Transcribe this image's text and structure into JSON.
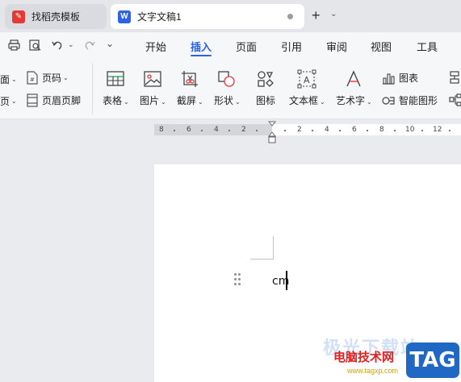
{
  "tabs": [
    {
      "title": "找稻壳模板",
      "icon": "docer-icon",
      "color": "#e53935"
    },
    {
      "title": "文字文稿1",
      "icon": "word-doc-icon",
      "color": "#2b62e8"
    }
  ],
  "new_tab": "+",
  "quick_access": [
    "print-icon",
    "print-preview-icon",
    "undo-icon",
    "redo-icon",
    "more-icon"
  ],
  "menu": [
    "开始",
    "插入",
    "页面",
    "引用",
    "审阅",
    "视图",
    "工具"
  ],
  "active_menu": "插入",
  "ribbon": {
    "small_left": [
      "面",
      "页"
    ],
    "small": [
      {
        "label": "页码",
        "icon": "page-number-icon"
      },
      {
        "label": "页眉页脚",
        "icon": "header-footer-icon"
      }
    ],
    "big": [
      {
        "label": "表格",
        "icon": "table-icon"
      },
      {
        "label": "图片",
        "icon": "picture-icon"
      },
      {
        "label": "截屏",
        "icon": "screenshot-icon"
      },
      {
        "label": "形状",
        "icon": "shape-icon"
      },
      {
        "label": "图标",
        "icon": "icon-library-icon"
      },
      {
        "label": "文本框",
        "icon": "textbox-icon"
      },
      {
        "label": "艺术字",
        "icon": "wordart-icon"
      }
    ],
    "right": [
      {
        "label": "图表",
        "icon": "chart-icon"
      },
      {
        "label": "智能图形",
        "icon": "smartart-icon"
      }
    ]
  },
  "ruler": {
    "left_ticks": [
      "8",
      "6",
      "4",
      "2"
    ],
    "right_ticks": [
      "2",
      "4",
      "6",
      "8",
      "10",
      "12"
    ]
  },
  "document": {
    "text": "cm"
  },
  "watermark": {
    "bg_text": "极光下载站",
    "name": "电脑技术网",
    "url": "www.tagxp.com",
    "tag": "TAG"
  }
}
